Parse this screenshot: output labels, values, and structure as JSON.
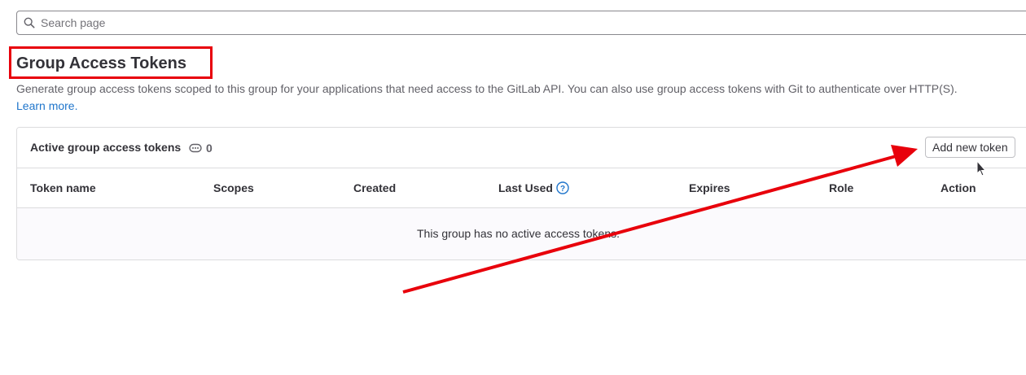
{
  "search": {
    "placeholder": "Search page"
  },
  "page": {
    "title": "Group Access Tokens",
    "description": "Generate group access tokens scoped to this group for your applications that need access to the GitLab API. You can also use group access tokens with Git to authenticate over HTTP(S).",
    "learn_more": "Learn more."
  },
  "card": {
    "header_label": "Active group access tokens",
    "count": "0",
    "add_button": "Add new token",
    "columns": [
      "Token name",
      "Scopes",
      "Created",
      "Last Used",
      "Expires",
      "Role",
      "Action"
    ],
    "empty_message": "This group has no active access tokens."
  },
  "colors": {
    "accent": "#1f75cb",
    "annotation": "#e8000b"
  },
  "icons": [
    "search-icon",
    "token-icon",
    "question-icon",
    "pointer-cursor",
    "annotation-arrow"
  ]
}
